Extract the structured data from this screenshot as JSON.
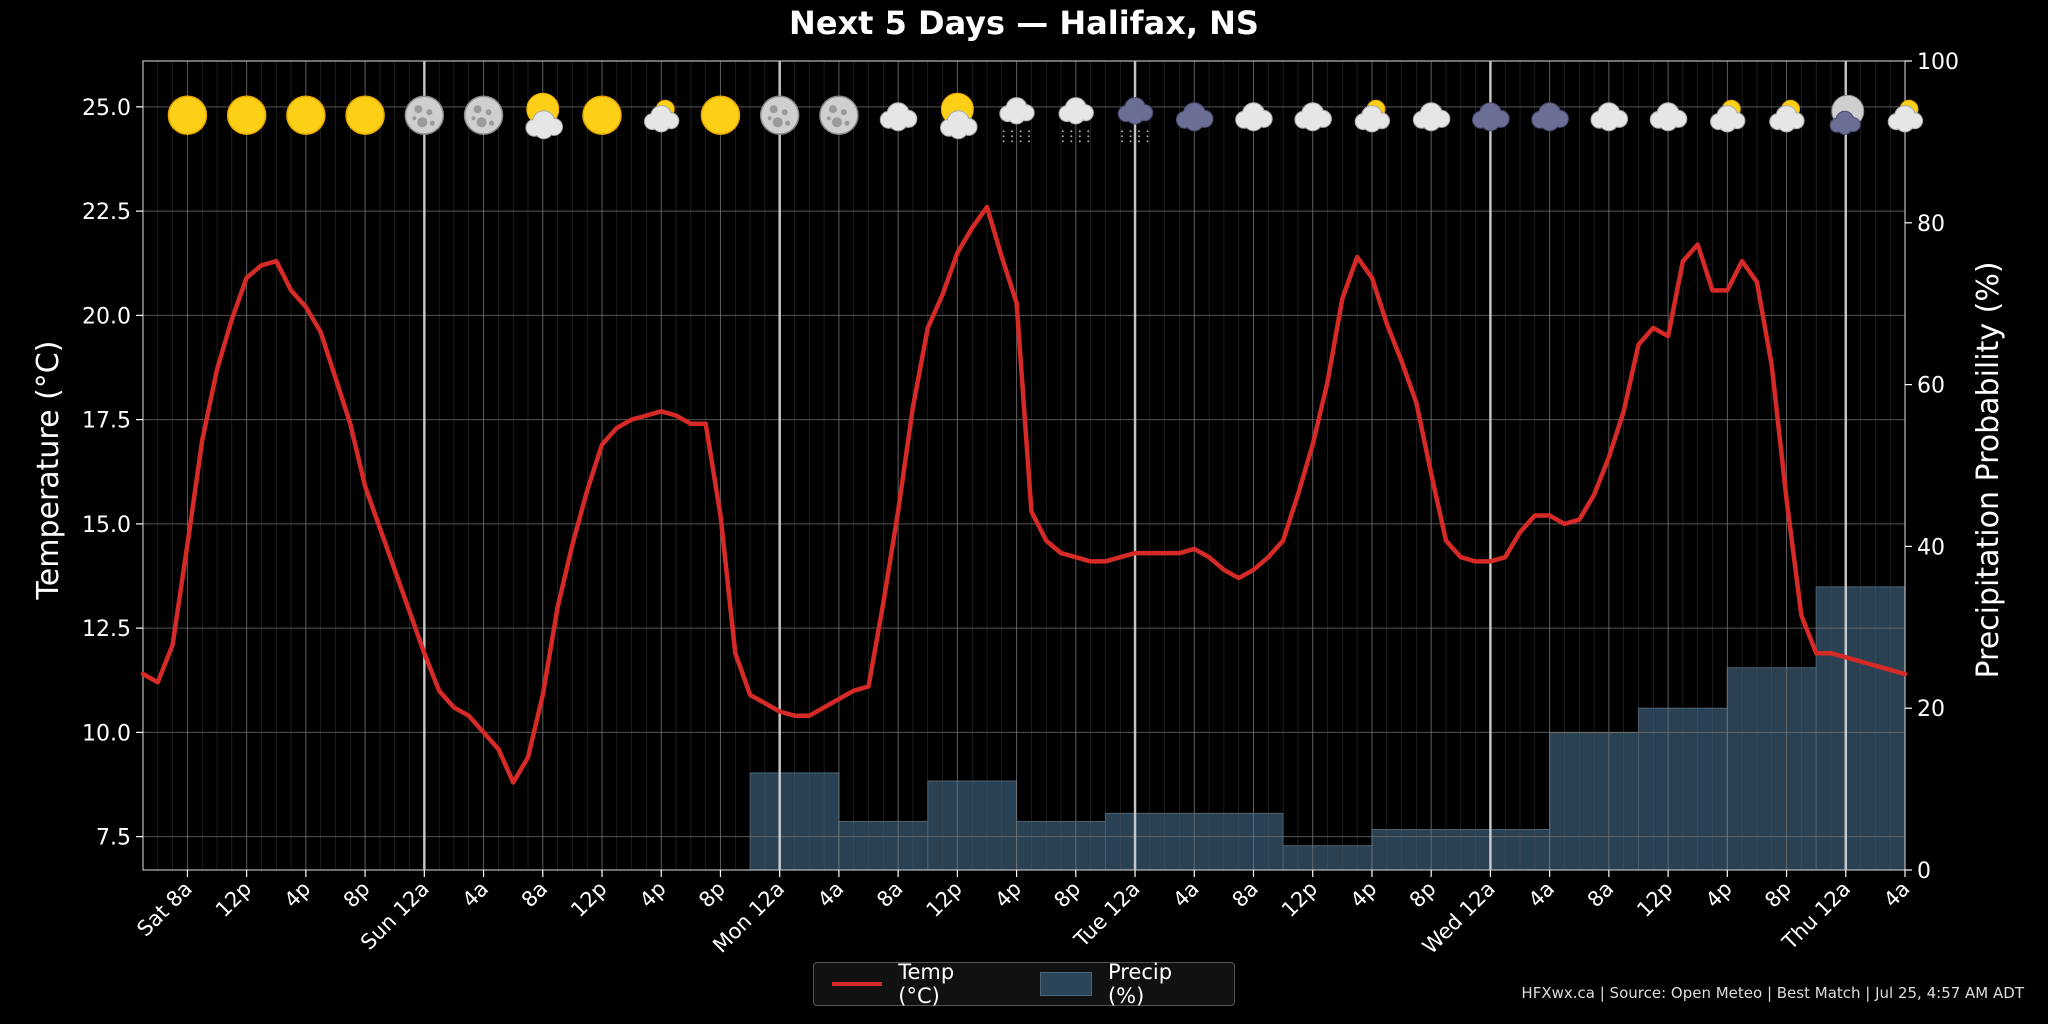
{
  "chart_data": {
    "type": "line",
    "title": "Next 5 Days — Halifax, NS",
    "ylabel": "Temperature (°C)",
    "y2label": "Precipitation Probability (%)",
    "ylim": [
      6.7,
      26.1
    ],
    "y2lim": [
      0,
      100
    ],
    "yticks": [
      "7.5",
      "10.0",
      "12.5",
      "15.0",
      "17.5",
      "20.0",
      "22.5",
      "25.0"
    ],
    "y2ticks": [
      "0",
      "20",
      "40",
      "60",
      "80",
      "100"
    ],
    "x_start_hour": 5,
    "x_end_hour": 124,
    "xticks": [
      {
        "h": 8,
        "label": "Sat 8a"
      },
      {
        "h": 12,
        "label": "12p"
      },
      {
        "h": 16,
        "label": "4p"
      },
      {
        "h": 20,
        "label": "8p"
      },
      {
        "h": 24,
        "label": "Sun 12a"
      },
      {
        "h": 28,
        "label": "4a"
      },
      {
        "h": 32,
        "label": "8a"
      },
      {
        "h": 36,
        "label": "12p"
      },
      {
        "h": 40,
        "label": "4p"
      },
      {
        "h": 44,
        "label": "8p"
      },
      {
        "h": 48,
        "label": "Mon 12a"
      },
      {
        "h": 52,
        "label": "4a"
      },
      {
        "h": 56,
        "label": "8a"
      },
      {
        "h": 60,
        "label": "12p"
      },
      {
        "h": 64,
        "label": "4p"
      },
      {
        "h": 68,
        "label": "8p"
      },
      {
        "h": 72,
        "label": "Tue 12a"
      },
      {
        "h": 76,
        "label": "4a"
      },
      {
        "h": 80,
        "label": "8a"
      },
      {
        "h": 84,
        "label": "12p"
      },
      {
        "h": 88,
        "label": "4p"
      },
      {
        "h": 92,
        "label": "8p"
      },
      {
        "h": 96,
        "label": "Wed 12a"
      },
      {
        "h": 100,
        "label": "4a"
      },
      {
        "h": 104,
        "label": "8a"
      },
      {
        "h": 108,
        "label": "12p"
      },
      {
        "h": 112,
        "label": "4p"
      },
      {
        "h": 116,
        "label": "8p"
      },
      {
        "h": 120,
        "label": "Thu 12a"
      },
      {
        "h": 124,
        "label": "4a"
      }
    ],
    "day_lines": [
      24,
      48,
      72,
      96,
      120
    ],
    "series": [
      {
        "name": "Temp (°C)",
        "color": "#d62a27",
        "x": [
          5,
          6,
          7,
          8,
          9,
          10,
          11,
          12,
          13,
          14,
          15,
          16,
          17,
          18,
          19,
          20,
          21,
          22,
          23,
          24,
          25,
          26,
          27,
          28,
          29,
          30,
          31,
          32,
          33,
          34,
          35,
          36,
          37,
          38,
          39,
          40,
          41,
          42,
          43,
          44,
          45,
          46,
          47,
          48,
          49,
          50,
          51,
          52,
          53,
          54,
          55,
          56,
          57,
          58,
          59,
          60,
          61,
          62,
          63,
          64,
          65,
          66,
          67,
          68,
          69,
          70,
          71,
          72,
          73,
          74,
          75,
          76,
          77,
          78,
          79,
          80,
          81,
          82,
          83,
          84,
          85,
          86,
          87,
          88,
          89,
          90,
          91,
          92,
          93,
          94,
          95,
          96,
          97,
          98,
          99,
          100,
          101,
          102,
          103,
          104,
          105,
          106,
          107,
          108,
          109,
          110,
          111,
          112,
          113,
          114,
          115,
          116,
          117,
          118,
          119,
          120,
          121,
          122,
          123,
          124
        ],
        "values": [
          11.4,
          11.2,
          12.1,
          14.5,
          17.0,
          18.7,
          19.9,
          20.9,
          21.2,
          21.3,
          20.6,
          20.2,
          19.6,
          18.5,
          17.4,
          15.9,
          14.9,
          13.9,
          12.9,
          11.9,
          11.0,
          10.6,
          10.4,
          10.0,
          9.6,
          8.8,
          9.4,
          10.9,
          13.0,
          14.5,
          15.8,
          16.9,
          17.3,
          17.5,
          17.6,
          17.7,
          17.6,
          17.4,
          17.4,
          15.2,
          11.9,
          10.9,
          10.7,
          10.5,
          10.4,
          10.4,
          10.6,
          10.8,
          11.0,
          11.1,
          13.1,
          15.3,
          17.8,
          19.7,
          20.5,
          21.5,
          22.1,
          22.6,
          21.4,
          20.3,
          15.3,
          14.6,
          14.3,
          14.2,
          14.1,
          14.1,
          14.2,
          14.3,
          14.3,
          14.3,
          14.3,
          14.4,
          14.2,
          13.9,
          13.7,
          13.9,
          14.2,
          14.6,
          15.7,
          16.9,
          18.4,
          20.4,
          21.4,
          20.9,
          19.8,
          18.9,
          17.9,
          16.2,
          14.6,
          14.2,
          14.1,
          14.1,
          14.2,
          14.8,
          15.2,
          15.2,
          15.0,
          15.1,
          15.7,
          16.6,
          17.7,
          19.3,
          19.7,
          19.5,
          21.3,
          21.7,
          20.6,
          20.6,
          21.3,
          20.8,
          18.8,
          15.6,
          12.8,
          11.9,
          11.9,
          11.8,
          11.7,
          11.6,
          11.5,
          11.4
        ]
      },
      {
        "name": "Precip (%)",
        "type": "bar",
        "color": "#2c4458",
        "steps": [
          {
            "from": 46,
            "to": 52,
            "value": 12
          },
          {
            "from": 52,
            "to": 58,
            "value": 6
          },
          {
            "from": 58,
            "to": 64,
            "value": 11
          },
          {
            "from": 64,
            "to": 70,
            "value": 6
          },
          {
            "from": 70,
            "to": 82,
            "value": 7
          },
          {
            "from": 82,
            "to": 88,
            "value": 3
          },
          {
            "from": 88,
            "to": 100,
            "value": 5
          },
          {
            "from": 100,
            "to": 106,
            "value": 17
          },
          {
            "from": 106,
            "to": 112,
            "value": 20
          },
          {
            "from": 112,
            "to": 118,
            "value": 25
          },
          {
            "from": 118,
            "to": 124,
            "value": 35
          }
        ]
      }
    ],
    "icons": [
      {
        "h": 8,
        "type": "sun"
      },
      {
        "h": 12,
        "type": "sun"
      },
      {
        "h": 16,
        "type": "sun"
      },
      {
        "h": 20,
        "type": "sun"
      },
      {
        "h": 24,
        "type": "moon"
      },
      {
        "h": 28,
        "type": "moon"
      },
      {
        "h": 32,
        "type": "sun-cloud"
      },
      {
        "h": 36,
        "type": "sun"
      },
      {
        "h": 40,
        "type": "cloud-sun-small"
      },
      {
        "h": 44,
        "type": "sun"
      },
      {
        "h": 48,
        "type": "moon"
      },
      {
        "h": 52,
        "type": "moon"
      },
      {
        "h": 56,
        "type": "cloud"
      },
      {
        "h": 60,
        "type": "sun-cloud"
      },
      {
        "h": 64,
        "type": "cloud-drizzle"
      },
      {
        "h": 68,
        "type": "cloud-drizzle"
      },
      {
        "h": 72,
        "type": "dark-cloud-drizzle"
      },
      {
        "h": 76,
        "type": "dark-cloud"
      },
      {
        "h": 80,
        "type": "cloud"
      },
      {
        "h": 84,
        "type": "cloud"
      },
      {
        "h": 88,
        "type": "cloud-sun-small"
      },
      {
        "h": 92,
        "type": "cloud"
      },
      {
        "h": 96,
        "type": "dark-cloud"
      },
      {
        "h": 100,
        "type": "dark-cloud"
      },
      {
        "h": 104,
        "type": "cloud"
      },
      {
        "h": 108,
        "type": "cloud"
      },
      {
        "h": 112,
        "type": "cloud-sun-small"
      },
      {
        "h": 116,
        "type": "cloud-sun-small"
      },
      {
        "h": 120,
        "type": "moon-cloud"
      },
      {
        "h": 124,
        "type": "cloud-sun-small"
      }
    ],
    "legend": {
      "placement": "bottom-center",
      "temp_label": "Temp (°C)",
      "precip_label": "Precip (%)"
    }
  },
  "footer": {
    "text": "HFXwx.ca | Source: Open Meteo | Best Match | Jul 25, 4:57 AM ADT"
  }
}
